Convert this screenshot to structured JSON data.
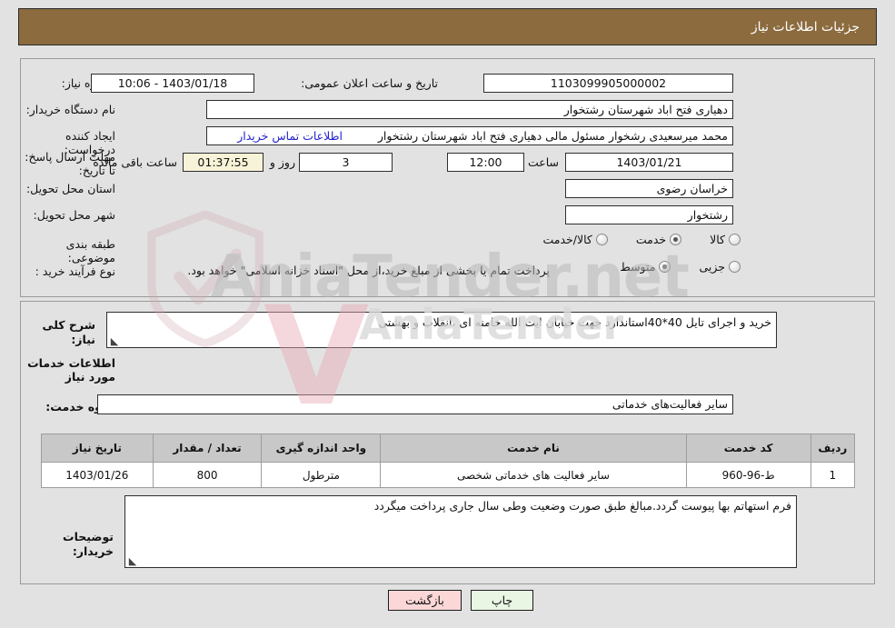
{
  "header": {
    "title": "جزئیات اطلاعات نیاز",
    "bg_color": "#8c6b3f"
  },
  "watermark": {
    "brand": "AniaTender.net",
    "mark_v": "V",
    "mark_word": "AniaTender"
  },
  "form": {
    "need_number": {
      "label": "شماره نیاز:",
      "value": "1103099905000002"
    },
    "announce_datetime": {
      "label": "تاریخ و ساعت اعلان عمومی:",
      "value": "1403/01/18 - 10:06"
    },
    "buyer_org": {
      "label": "نام دستگاه خریدار:",
      "value": "دهیاری فتح اباد شهرستان رشتخوار"
    },
    "requester": {
      "label": "ایجاد کننده درخواست:",
      "value": "محمد میرسعیدی رشخوار مسئول مالی دهیاری فتح اباد شهرستان رشتخوار"
    },
    "contact_link": "اطلاعات تماس خریدار",
    "deadline": {
      "label": "مهلت ارسال پاسخ: تا تاریخ:",
      "date": "1403/01/21",
      "hour_label": "ساعت",
      "hour": "12:00",
      "days": "3",
      "days_suffix": "روز و",
      "countdown": "01:37:55",
      "countdown_suffix": "ساعت باقی مانده"
    },
    "province": {
      "label": "استان محل تحویل:",
      "value": "خراسان رضوی"
    },
    "city": {
      "label": "شهر محل تحویل:",
      "value": "رشتخوار"
    },
    "category": {
      "label": "طبقه بندی موضوعی:",
      "options": [
        "کالا",
        "خدمت",
        "کالا/خدمت"
      ],
      "selected": "خدمت"
    },
    "purchase_type": {
      "label": "نوع فرآیند خرید :",
      "options": [
        "جزیی",
        "متوسط"
      ],
      "selected": "متوسط",
      "note": "پرداخت تمام یا بخشی از مبلغ خرید،از محل \"اسناد خزانه اسلامی\" خواهد بود."
    }
  },
  "description": {
    "label": "شرح کلی نیاز:",
    "value": "خرید و اجرای تایل 40*40استاندارد جهت خیابان ایت الله خامنه ای ،انقلاب و بهشتی"
  },
  "services_section": {
    "heading": "اطلاعات خدمات مورد نیاز",
    "group_label": "گروه خدمت:",
    "group_value": "سایر فعالیت‌های خدماتی"
  },
  "table": {
    "columns": [
      "ردیف",
      "کد خدمت",
      "نام خدمت",
      "واحد اندازه گیری",
      "تعداد / مقدار",
      "تاریخ نیاز"
    ],
    "rows": [
      {
        "row_no": "1",
        "service_code": "ط-96-960",
        "service_name": "سایر فعالیت های خدماتی شخصی",
        "unit": "مترطول",
        "quantity": "800",
        "need_date": "1403/01/26"
      }
    ]
  },
  "buyer_notes": {
    "label": "توضیحات خریدار:",
    "value": "فرم استهاتم بها پیوست گردد.مبالغ  طبق صورت وضعیت وطی سال جاری پرداخت میگردد"
  },
  "buttons": {
    "print": "چاپ",
    "back": "بازگشت"
  }
}
